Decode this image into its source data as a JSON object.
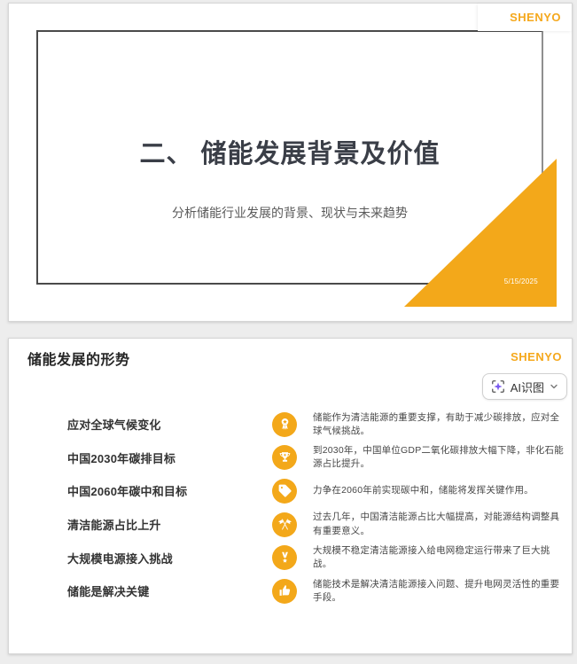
{
  "page": {
    "background_color": "#EDEDED",
    "card_color": "#FFFFFF"
  },
  "brand": {
    "name": "SHENYO",
    "logo_color": "#F5A81C",
    "accent_yellow": "#F3A81A"
  },
  "slide1": {
    "logo": "SHENYO",
    "title": "二、 储能发展背景及价值",
    "subtitle": "分析储能行业发展的背景、现状与未来趋势",
    "date": "5/15/2025",
    "colors": {
      "title_text": "#3A3E47",
      "subtitle_text": "#5A5A5A",
      "frame_border": "#4A4A4A",
      "corner_triangle": "#F3A81A",
      "date_text": "#FFFFFF"
    }
  },
  "slide2": {
    "logo": "SHENYO",
    "title": "储能发展的形势",
    "ai_button": {
      "label": "AI识图",
      "icon": "ai-scan-sparkle-icon",
      "icon_color": "#7B5CF0",
      "chevron_icon": "chevron-down-icon"
    },
    "icon_background": "#F3A81A",
    "rows": [
      {
        "label": "应对全球气候变化",
        "icon": "award-ribbon-icon",
        "desc": "储能作为清洁能源的重要支撑，有助于减少碳排放，应对全球气候挑战。"
      },
      {
        "label": "中国2030年碳排目标",
        "icon": "trophy-icon",
        "desc": "到2030年，中国单位GDP二氧化碳排放大幅下降，非化石能源占比提升。"
      },
      {
        "label": "中国2060年碳中和目标",
        "icon": "price-tag-icon",
        "desc": "力争在2060年前实现碳中和，储能将发挥关键作用。"
      },
      {
        "label": "清洁能源占比上升",
        "icon": "crossed-flags-icon",
        "desc": "过去几年，中国清洁能源占比大幅提高，对能源结构调整具有重要意义。"
      },
      {
        "label": "大规模电源接入挑战",
        "icon": "medal-icon",
        "desc": "大规模不稳定清洁能源接入给电网稳定运行带来了巨大挑战。"
      },
      {
        "label": "储能是解决关键",
        "icon": "thumbs-up-icon",
        "desc": "储能技术是解决清洁能源接入问题、提升电网灵活性的重要手段。"
      }
    ]
  }
}
